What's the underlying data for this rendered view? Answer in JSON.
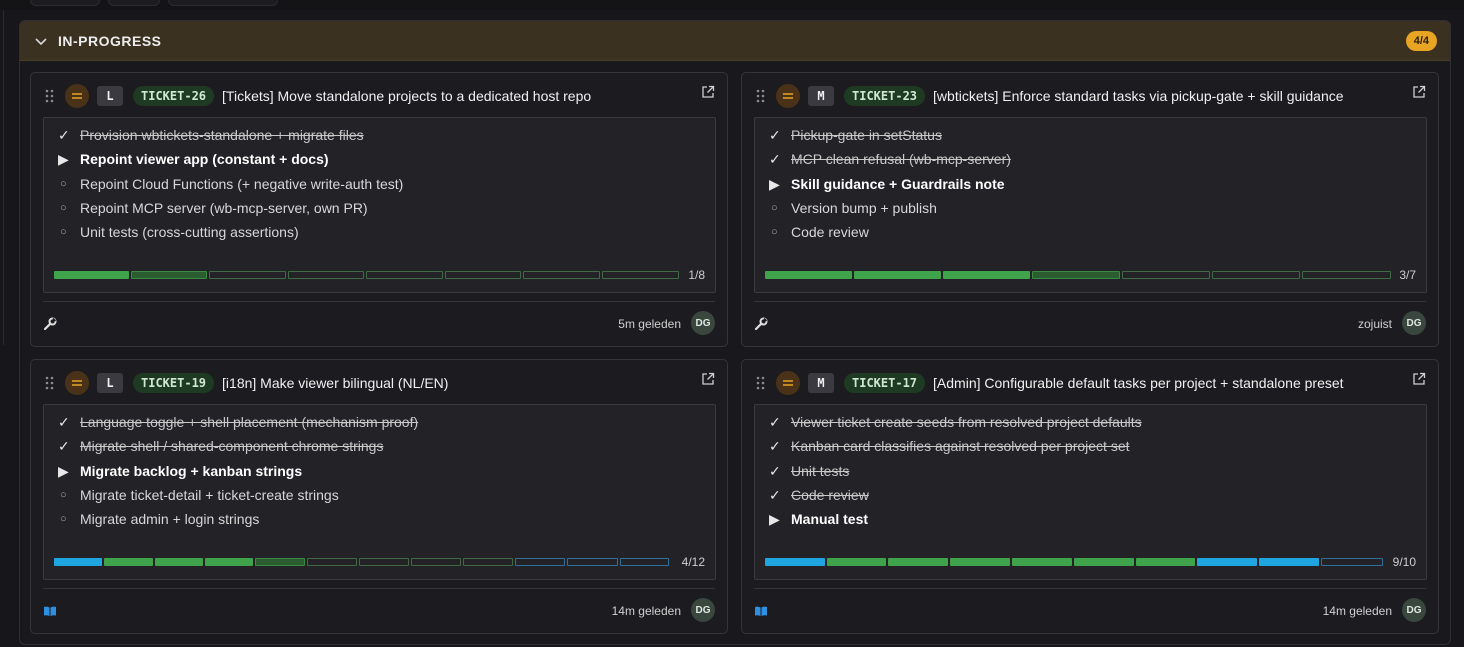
{
  "section": {
    "title": "IN-PROGRESS",
    "count": "4/4",
    "accent": "#e8a524"
  },
  "cards": [
    {
      "size": "L",
      "id": "TICKET-26",
      "title": "[Tickets] Move standalone projects to a dedicated host repo",
      "tasks": [
        {
          "text": "Provision wbtickets-standalone + migrate files",
          "state": "done"
        },
        {
          "text": "Repoint viewer app (constant + docs)",
          "state": "active"
        },
        {
          "text": "Repoint Cloud Functions (+ negative write-auth test)",
          "state": "todo"
        },
        {
          "text": "Repoint MCP server (wb-mcp-server, own PR)",
          "state": "todo"
        },
        {
          "text": "Unit tests (cross-cutting assertions)",
          "state": "todo"
        }
      ],
      "progress": "1/8",
      "footer_icon": "wrench-icon",
      "time": "5m geleden",
      "avatar": "DG"
    },
    {
      "size": "M",
      "id": "TICKET-23",
      "title": "[wbtickets] Enforce standard tasks via pickup-gate + skill guidance",
      "tasks": [
        {
          "text": "Pickup-gate in setStatus",
          "state": "done"
        },
        {
          "text": "MCP clean refusal (wb-mcp-server)",
          "state": "done"
        },
        {
          "text": "Skill guidance + Guardrails note",
          "state": "active"
        },
        {
          "text": "Version bump + publish",
          "state": "todo"
        },
        {
          "text": "Code review",
          "state": "todo"
        }
      ],
      "progress": "3/7",
      "footer_icon": "wrench-icon",
      "time": "zojuist",
      "avatar": "DG"
    },
    {
      "size": "L",
      "id": "TICKET-19",
      "title": "[i18n] Make viewer bilingual (NL/EN)",
      "tasks": [
        {
          "text": "Language toggle + shell placement (mechanism proof)",
          "state": "done"
        },
        {
          "text": "Migrate shell / shared-component chrome strings",
          "state": "done"
        },
        {
          "text": "Migrate backlog + kanban strings",
          "state": "active"
        },
        {
          "text": "Migrate ticket-detail + ticket-create strings",
          "state": "todo"
        },
        {
          "text": "Migrate admin + login strings",
          "state": "todo"
        }
      ],
      "progress": "4/12",
      "footer_icon": "book-icon",
      "time": "14m geleden",
      "avatar": "DG"
    },
    {
      "size": "M",
      "id": "TICKET-17",
      "title": "[Admin] Configurable default tasks per project + standalone preset",
      "tasks": [
        {
          "text": "Viewer ticket create seeds from resolved project defaults",
          "state": "done"
        },
        {
          "text": "Kanban card classifies against resolved per project set",
          "state": "done"
        },
        {
          "text": "Unit tests",
          "state": "done"
        },
        {
          "text": "Code review",
          "state": "done"
        },
        {
          "text": "Manual test",
          "state": "active"
        }
      ],
      "progress": "9/10",
      "footer_icon": "book-icon",
      "time": "14m geleden",
      "avatar": "DG"
    }
  ]
}
